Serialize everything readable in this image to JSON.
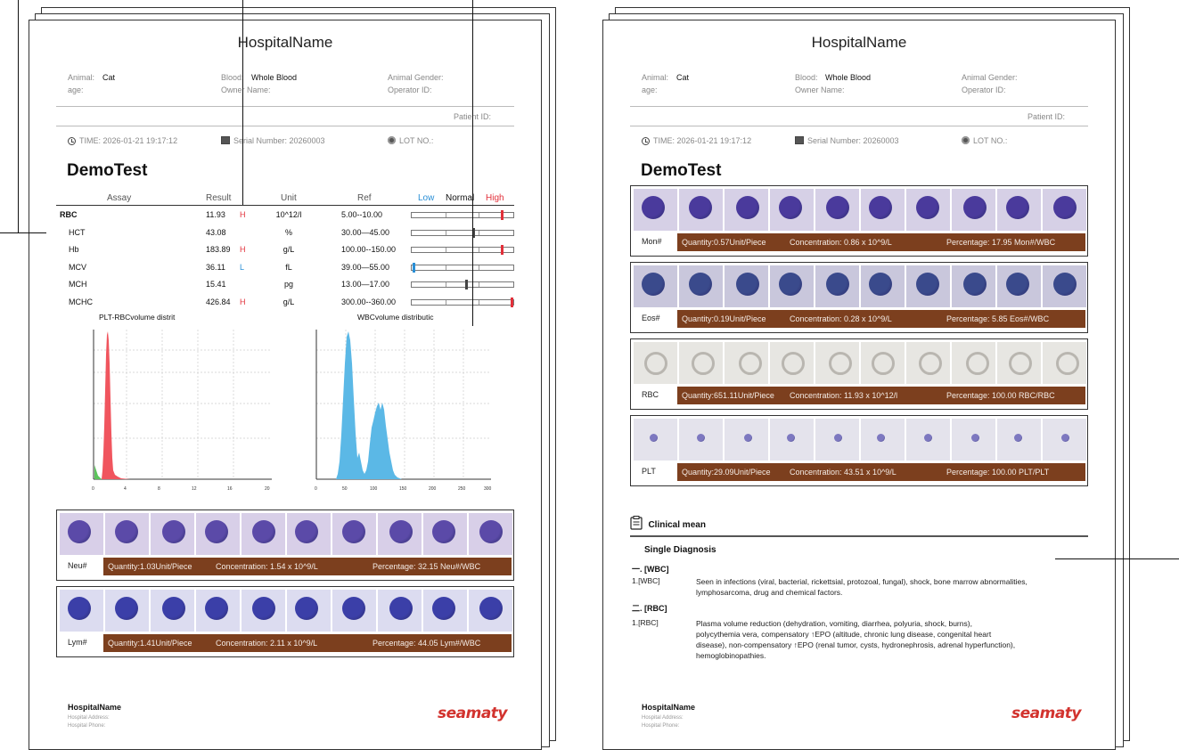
{
  "left_report": {
    "hospital_name": "HospitalName",
    "info": {
      "animal_label": "Animal:",
      "animal_value": "Cat",
      "age_label": "age:",
      "blood_label": "Blood:",
      "blood_value": "Whole Blood",
      "owner_label": "Owner Name:",
      "gender_label": "Animal Gender:",
      "operator_label": "Operator ID:",
      "patient_label": "Patient ID:"
    },
    "meta": {
      "time": "TIME: 2026-01-21 19:17:12",
      "serial": "Serial Number: 20260003",
      "lot": "LOT NO.:"
    },
    "test_name": "DemoTest",
    "table": {
      "headers": {
        "assay": "Assay",
        "result": "Result",
        "unit": "Unit",
        "ref": "Ref",
        "low": "Low",
        "normal": "Normal",
        "high": "High"
      },
      "rows": [
        {
          "name": "RBC",
          "result": "11.93",
          "flag": "H",
          "unit": "10^12/l",
          "ref": "5.00--10.00",
          "level": 0.89,
          "bold": true
        },
        {
          "name": "HCT",
          "result": "43.08",
          "flag": "",
          "unit": "%",
          "ref": "30.00—45.00",
          "level": 0.61
        },
        {
          "name": "Hb",
          "result": "183.89",
          "flag": "H",
          "unit": "g/L",
          "ref": "100.00--150.00",
          "level": 0.89
        },
        {
          "name": "MCV",
          "result": "36.11",
          "flag": "L",
          "unit": "fL",
          "ref": "39.00—55.00",
          "level": 0.02
        },
        {
          "name": "MCH",
          "result": "15.41",
          "flag": "",
          "unit": "pg",
          "ref": "13.00—17.00",
          "level": 0.54
        },
        {
          "name": "MCHC",
          "result": "426.84",
          "flag": "H",
          "unit": "g/L",
          "ref": "300.00--360.00",
          "level": 0.99
        }
      ]
    },
    "histograms": {
      "plt_rbc_title": "PLT-RBCvolume distrit",
      "wbc_title": "WBCvolume distributic"
    },
    "cell_groups": [
      {
        "label": "Neu#",
        "quantity": "Quantity:1.03Unit/Piece",
        "concentration": "Concentration:   1.54 x 10^9/L",
        "percentage": "Percentage:  32.15 Neu#/WBC"
      },
      {
        "label": "Lym#",
        "quantity": "Quantity:1.41Unit/Piece",
        "concentration": "Concentration:   2.11 x 10^9/L",
        "percentage": "Percentage:  44.05 Lym#/WBC"
      }
    ],
    "footer": {
      "name": "HospitalName",
      "address": "Hospital Address:",
      "phone": "Hospital Phone:",
      "logo": "seamaty"
    }
  },
  "right_report": {
    "hospital_name": "HospitalName",
    "info": {
      "animal_label": "Animal:",
      "animal_value": "Cat",
      "age_label": "age:",
      "blood_label": "Blood:",
      "blood_value": "Whole Blood",
      "owner_label": "Owner Name:",
      "gender_label": "Animal Gender:",
      "operator_label": "Operator ID:",
      "patient_label": "Patient ID:"
    },
    "meta": {
      "time": "TIME: 2026-01-21 19:17:12",
      "serial": "Serial Number: 20260003",
      "lot": "LOT NO.:"
    },
    "test_name": "DemoTest",
    "cell_groups": [
      {
        "label": "Mon#",
        "quantity": "Quantity:0.57Unit/Piece",
        "concentration": "Concentration:   0.86 x 10^9/L",
        "percentage": "Percentage:  17.95 Mon#/WBC"
      },
      {
        "label": "Eos#",
        "quantity": "Quantity:0.19Unit/Piece",
        "concentration": "Concentration:   0.28 x 10^9/L",
        "percentage": "Percentage:  5.85 Eos#/WBC"
      },
      {
        "label": "RBC",
        "quantity": "Quantity:651.11Unit/Piece",
        "concentration": "Concentration:   11.93 x 10^12/l",
        "percentage": "Percentage:  100.00 RBC/RBC"
      },
      {
        "label": "PLT",
        "quantity": "Quantity:29.09Unit/Piece",
        "concentration": "Concentration:   43.51 x 10^9/L",
        "percentage": "Percentage:  100.00 PLT/PLT"
      }
    ],
    "clinical": {
      "title": "Clinical mean",
      "single": "Single Diagnosis",
      "sections": [
        {
          "head": "一. [WBC]",
          "num": "1.[WBC]",
          "text": "Seen in infections (viral, bacterial, rickettsial, protozoal, fungal), shock, bone marrow abnormalities, lymphosarcoma, drug and chemical factors."
        },
        {
          "head": "二. [RBC]",
          "num": "1.[RBC]",
          "text": "Plasma volume reduction (dehydration, vomiting, diarrhea, polyuria, shock, burns), polycythemia vera, compensatory ↑EPO (altitude, chronic lung disease, congenital heart disease), non-compensatory ↑EPO (renal tumor, cysts, hydronephrosis, adrenal hyperfunction), hemoglobinopathies."
        }
      ]
    },
    "footer": {
      "name": "HospitalName",
      "address": "Hospital Address:",
      "phone": "Hospital Phone:",
      "logo": "seamaty"
    }
  },
  "colors": {
    "flag_high": "#e2303a",
    "flag_low": "#2a8fd6",
    "info_bar": "#7c3f1e",
    "plt_hist": "#f0555e",
    "wbc_hist": "#5bb8e6",
    "logo": "#d2332e"
  }
}
